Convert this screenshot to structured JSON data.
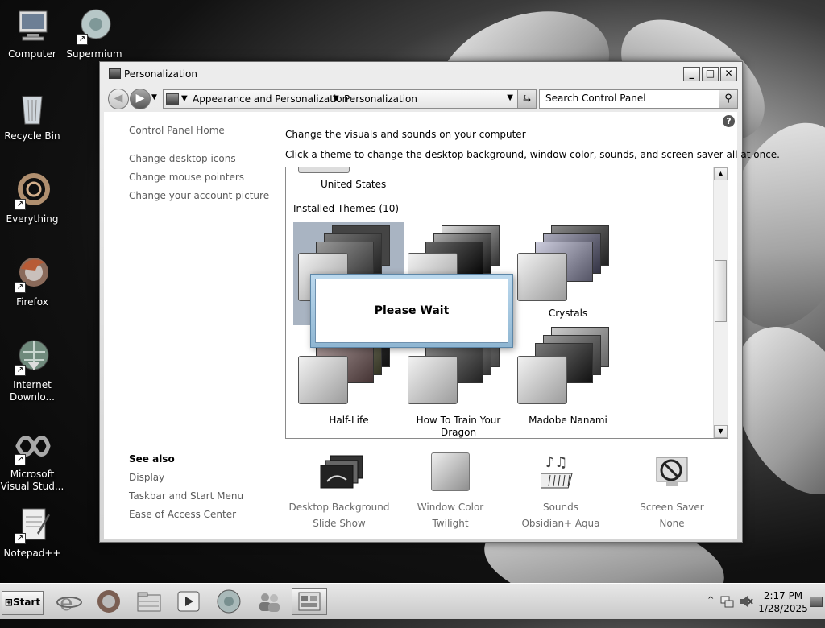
{
  "desktop": {
    "icons": [
      {
        "label": "Computer"
      },
      {
        "label": "Supermium"
      },
      {
        "label": "Recycle Bin"
      },
      {
        "label": "Everything"
      },
      {
        "label": "Firefox"
      },
      {
        "label": "Internet Downlo..."
      },
      {
        "label": "Microsoft Visual Stud..."
      },
      {
        "label": "Notepad++"
      }
    ]
  },
  "window": {
    "title": "Personalization",
    "controls": {
      "minimize": "_",
      "maximize": "□",
      "close": "✕"
    },
    "breadcrumb": [
      "Appearance and Personalization",
      "Personalization"
    ],
    "search_placeholder": "Search Control Panel"
  },
  "sidebar": {
    "home": "Control Panel Home",
    "links": [
      "Change desktop icons",
      "Change mouse pointers",
      "Change your account picture"
    ],
    "see_also_title": "See also",
    "see_also": [
      "Display",
      "Taskbar and Start Menu",
      "Ease of Access Center"
    ]
  },
  "main": {
    "heading": "Change the visuals and sounds on your computer",
    "subheading": "Click a theme to change the desktop background, window color, sounds, and screen saver all at once.",
    "previous_group_last": "United States",
    "installed_label": "Installed Themes (10)",
    "themes": [
      {
        "name": ""
      },
      {
        "name": ""
      },
      {
        "name": "Crystals"
      },
      {
        "name": "Half-Life"
      },
      {
        "name": "How To Train Your Dragon"
      },
      {
        "name": "Madobe Nanami"
      }
    ]
  },
  "dialog": {
    "message": "Please Wait"
  },
  "bottom": [
    {
      "title": "Desktop Background",
      "value": "Slide Show"
    },
    {
      "title": "Window Color",
      "value": "Twilight"
    },
    {
      "title": "Sounds",
      "value": "Obsidian+ Aqua"
    },
    {
      "title": "Screen Saver",
      "value": "None"
    }
  ],
  "taskbar": {
    "start_label": "Start",
    "time": "2:17 PM",
    "date": "1/28/2025"
  }
}
